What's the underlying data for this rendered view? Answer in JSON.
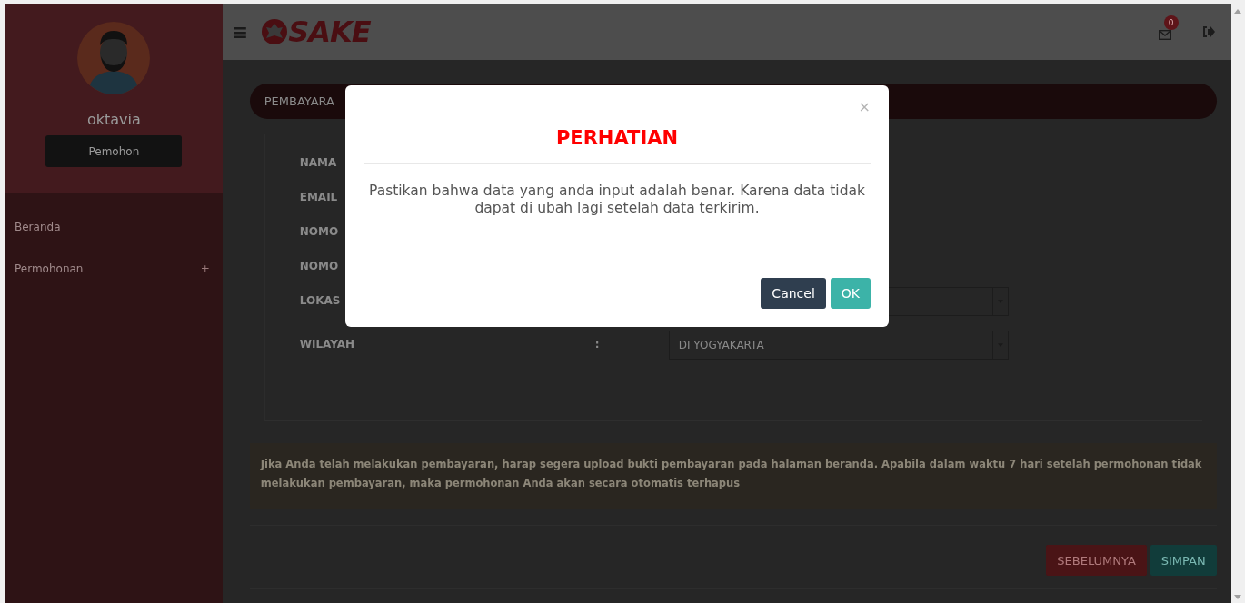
{
  "sidebar": {
    "user_name": "oktavia",
    "role_button": "Pemohon",
    "menu": [
      {
        "label": "Beranda"
      },
      {
        "label": "Permohonan",
        "toggle": "+"
      }
    ]
  },
  "topbar": {
    "menu_icon": "≡",
    "logo_text": "SAKE",
    "notification_count": "0"
  },
  "section_title": "PEMBAYARA",
  "form": {
    "fields": [
      {
        "label": "NAMA",
        "kind": "text"
      },
      {
        "label": "EMAIL",
        "kind": "text"
      },
      {
        "label": "NOMO",
        "kind": "text"
      },
      {
        "label": "NOMO",
        "kind": "text"
      },
      {
        "label": "LOKAS",
        "kind": "select"
      },
      {
        "label": "WILAYAH",
        "colon": ":",
        "kind": "select",
        "value": "DI YOGYAKARTA"
      }
    ]
  },
  "notice": "Jika Anda telah melakukan pembayaran, harap segera upload bukti pembayaran pada halaman beranda. Apabila dalam waktu 7 hari setelah permohonan tidak melakukan pembayaran, maka permohonan Anda akan secara otomatis terhapus",
  "buttons": [
    {
      "label": "SEBELUMNYA",
      "kind": "back"
    },
    {
      "label": "SIMPAN",
      "kind": "save"
    }
  ],
  "dialog": {
    "title": "PERHATIAN",
    "close": "×",
    "message": "Pastikan bahwa data yang anda input adalah benar. Karena data tidak dapat di ubah lagi setelah data terkirim.",
    "buttons": [
      {
        "label": "Cancel",
        "kind": "cancel"
      },
      {
        "label": "OK",
        "kind": "confirm"
      }
    ]
  }
}
